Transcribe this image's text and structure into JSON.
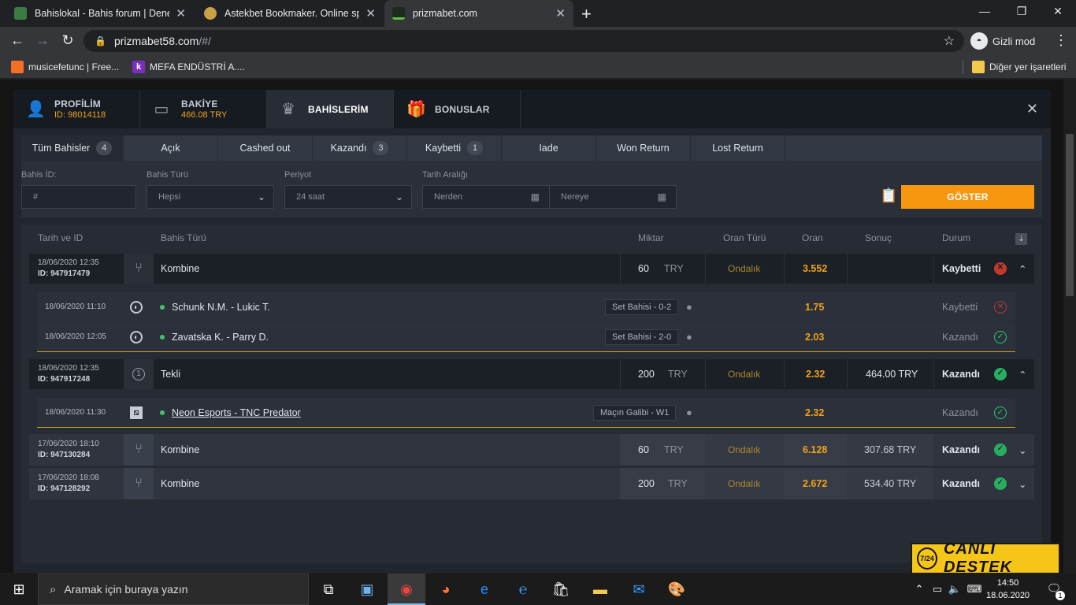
{
  "browser": {
    "tabs": [
      {
        "title": "Bahislokal - Bahis forum | Denem",
        "close": "✕"
      },
      {
        "title": "Astekbet Bookmaker. Online spo",
        "close": "✕"
      },
      {
        "title": "prizmabet.com",
        "close": "✕"
      }
    ],
    "new_tab": "+",
    "url_domain": "prizmabet58.com",
    "url_path": "/#/",
    "incognito_label": "Gizli mod",
    "bookmarks": [
      {
        "label": "musicefetunc | Free..."
      },
      {
        "label": "MEFA ENDÜSTRİ A...."
      }
    ],
    "other_bookmarks": "Diğer yer işaretleri"
  },
  "modal": {
    "tabs": [
      {
        "label": "PROFİLİM",
        "sub": "ID: 98014118",
        "icon": "user-icon"
      },
      {
        "label": "BAKİYE",
        "sub": "466.08 TRY",
        "icon": "wallet-icon"
      },
      {
        "label": "BAHİSLERİM",
        "sub": "",
        "icon": "trophy-icon"
      },
      {
        "label": "BONUSLAR",
        "sub": "",
        "icon": "gift-icon"
      }
    ],
    "close": "✕"
  },
  "filters": {
    "subtabs": [
      {
        "label": "Tüm Bahisler",
        "count": "4"
      },
      {
        "label": "Açık",
        "count": ""
      },
      {
        "label": "Cashed out",
        "count": ""
      },
      {
        "label": "Kazandı",
        "count": "3"
      },
      {
        "label": "Kaybetti",
        "count": "1"
      },
      {
        "label": "Iade",
        "count": ""
      },
      {
        "label": "Won Return",
        "count": ""
      },
      {
        "label": "Lost Return",
        "count": ""
      }
    ],
    "bet_id_label": "Bahis İD:",
    "bet_id_placeholder": "#",
    "bet_type_label": "Bahis Türü",
    "bet_type_value": "Hepsi",
    "period_label": "Periyot",
    "period_value": "24 saat",
    "date_range_label": "Tarih Aralığı",
    "from_placeholder": "Nerden",
    "to_placeholder": "Nereye",
    "show_button": "GÖSTER"
  },
  "table": {
    "headers": {
      "date_id": "Tarih ve ID",
      "bet_type": "Bahis Türü",
      "amount": "Miktar",
      "odds_type": "Oran Türü",
      "odds": "Oran",
      "result": "Sonuç",
      "status": "Durum"
    },
    "bets": [
      {
        "date": "18/06/2020 12:35",
        "id": "ID: 947917479",
        "type": "Kombine",
        "amount": "60",
        "currency": "TRY",
        "odds_type": "Ondalık",
        "odds": "3.552",
        "result": "",
        "status": "Kaybetti"
      },
      {
        "date": "18/06/2020 12:35",
        "id": "ID: 947917248",
        "type": "Tekli",
        "amount": "200",
        "currency": "TRY",
        "odds_type": "Ondalık",
        "odds": "2.32",
        "result": "464.00 TRY",
        "status": "Kazandı"
      },
      {
        "date": "17/06/2020 18:10",
        "id": "ID: 947130284",
        "type": "Kombine",
        "amount": "60",
        "currency": "TRY",
        "odds_type": "Ondalık",
        "odds": "6.128",
        "result": "307.68 TRY",
        "status": "Kazandı"
      },
      {
        "date": "17/06/2020 18:08",
        "id": "ID: 947128292",
        "type": "Kombine",
        "amount": "200",
        "currency": "TRY",
        "odds_type": "Ondalık",
        "odds": "2.672",
        "result": "534.40 TRY",
        "status": "Kazandı"
      }
    ],
    "selections": [
      {
        "date": "18/06/2020 11:10",
        "event": "Schunk N.M. - Lukic T.",
        "market": "Set Bahisi - 0-2",
        "odds": "1.75",
        "status": "Kaybetti"
      },
      {
        "date": "18/06/2020 12:05",
        "event": "Zavatska K. - Parry D.",
        "market": "Set Bahisi - 2-0",
        "odds": "2.03",
        "status": "Kazandı"
      },
      {
        "date": "18/06/2020 11:30",
        "event": "Neon Esports - TNC Predator",
        "market": "Maçın Galibi - W1",
        "odds": "2.32",
        "status": "Kazandı"
      }
    ]
  },
  "taskbar": {
    "search_placeholder": "Aramak için buraya yazın",
    "time": "14:50",
    "date": "18.06.2020",
    "notif_count": "1"
  },
  "support_banner": {
    "badge": "7/24",
    "label": "CANLI DESTEK"
  },
  "colors": {
    "accent": "#f7960f",
    "odds_gold": "#f0a21c",
    "win": "#2ecc71",
    "loss": "#e74c3c"
  }
}
